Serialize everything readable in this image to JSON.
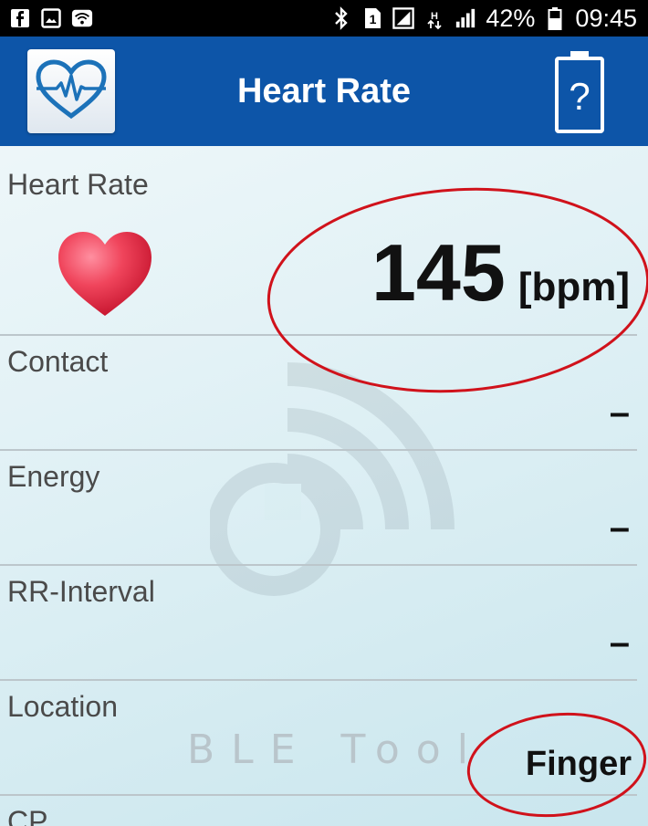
{
  "status_bar": {
    "battery_percent": "42%",
    "time": "09:45",
    "icons": [
      "facebook-icon",
      "gallery-icon",
      "wifi-icon",
      "bluetooth-icon",
      "sim-1-icon",
      "signal-1-icon",
      "data-icon",
      "signal-2-icon",
      "battery-icon"
    ]
  },
  "app_bar": {
    "title": "Heart Rate",
    "help_label": "?",
    "logo_icon": "heart-pulse-icon"
  },
  "rows": {
    "heart_rate": {
      "label": "Heart Rate",
      "value": "145",
      "unit": "[bpm]"
    },
    "contact": {
      "label": "Contact",
      "value": "–"
    },
    "energy": {
      "label": "Energy",
      "value": "–"
    },
    "rr_interval": {
      "label": "RR-Interval",
      "value": "–"
    },
    "location": {
      "label": "Location",
      "value": "Finger"
    },
    "cp": {
      "label": "CP"
    }
  },
  "watermark": {
    "text": "BLE Tool"
  },
  "colors": {
    "app_bar": "#0d55a8",
    "annotation_red": "#d0121b",
    "heart": "#e8324a"
  }
}
